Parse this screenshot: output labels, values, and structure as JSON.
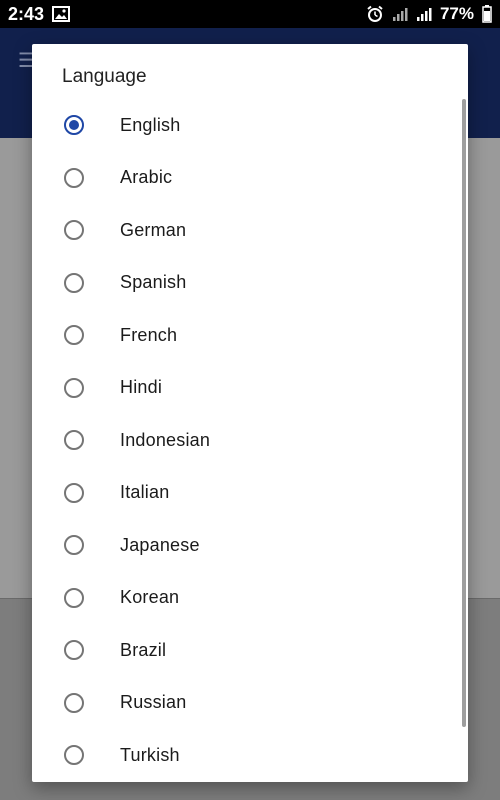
{
  "status_bar": {
    "time": "2:43",
    "battery_percent": "77%",
    "icons": [
      "image-icon",
      "alarm-icon",
      "signal-icon",
      "signal-icon",
      "battery-icon"
    ]
  },
  "dialog": {
    "title": "Language",
    "selected": "English",
    "options": [
      {
        "label": "English",
        "checked": true
      },
      {
        "label": "Arabic",
        "checked": false
      },
      {
        "label": "German",
        "checked": false
      },
      {
        "label": "Spanish",
        "checked": false
      },
      {
        "label": "French",
        "checked": false
      },
      {
        "label": "Hindi",
        "checked": false
      },
      {
        "label": "Indonesian",
        "checked": false
      },
      {
        "label": "Italian",
        "checked": false
      },
      {
        "label": "Japanese",
        "checked": false
      },
      {
        "label": "Korean",
        "checked": false
      },
      {
        "label": "Brazil",
        "checked": false
      },
      {
        "label": "Russian",
        "checked": false
      },
      {
        "label": "Turkish",
        "checked": false
      }
    ]
  },
  "colors": {
    "accent": "#1f47a6",
    "app_bar": "#1f3a8a",
    "radio_unchecked": "#757575"
  }
}
